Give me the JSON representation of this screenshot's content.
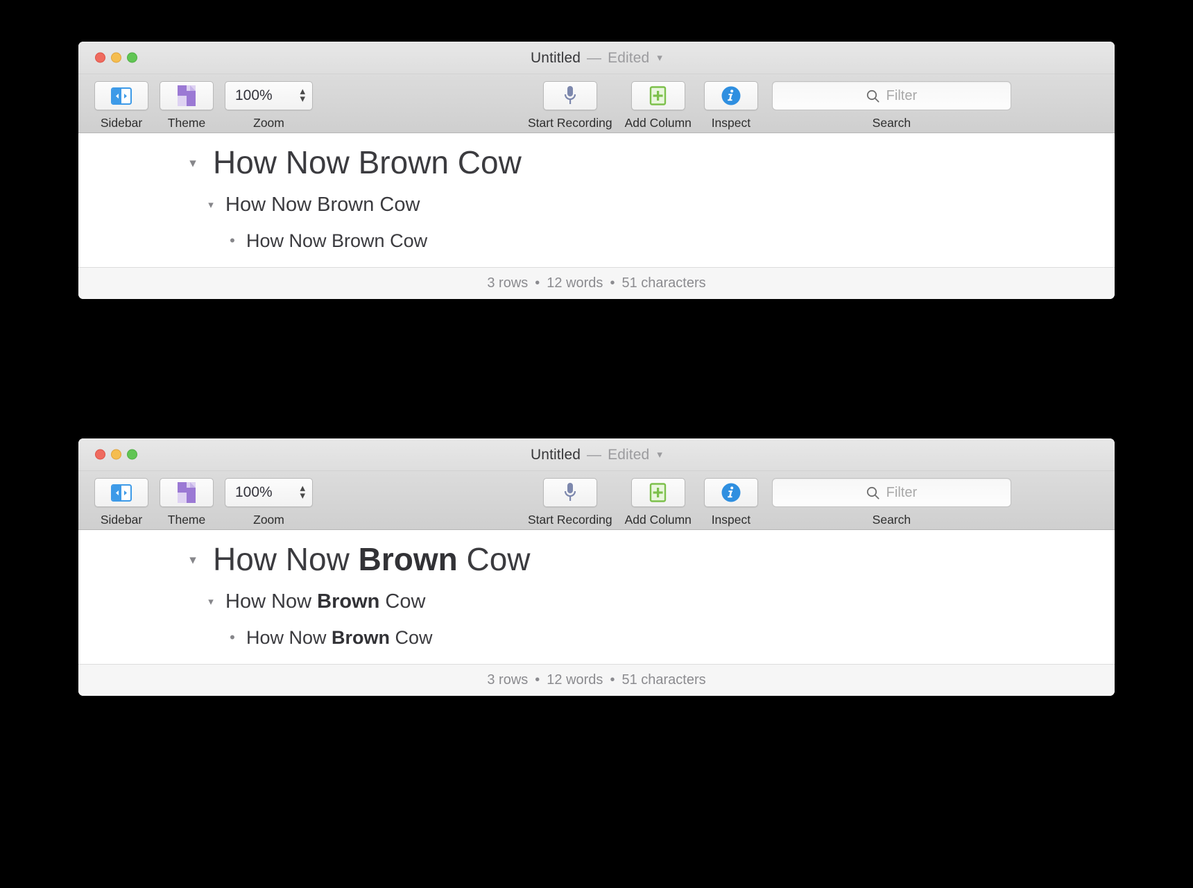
{
  "background_color": "#000000",
  "window": {
    "title": "Untitled",
    "separator": "—",
    "edited_label": "Edited",
    "chevron_icon": "chevron-down-icon",
    "traffic_lights": {
      "close": "#ef6b5f",
      "minimize": "#f5bd4f",
      "maximize": "#61c554"
    }
  },
  "toolbar": {
    "sidebar": {
      "label": "Sidebar",
      "icon": "sidebar-icon",
      "color": "#3d9ae8"
    },
    "theme": {
      "label": "Theme",
      "icon": "theme-icon",
      "color": "#9b79d4"
    },
    "zoom": {
      "label": "Zoom",
      "value": "100%",
      "stepper_icon": "stepper-updown-icon"
    },
    "record": {
      "label": "Start Recording",
      "icon": "microphone-icon",
      "color": "#7d88ad"
    },
    "add_column": {
      "label": "Add Column",
      "icon": "add-column-icon",
      "color": "#7cc04b"
    },
    "inspect": {
      "label": "Inspect",
      "icon": "info-circle-icon",
      "color": "#2f8fe0"
    },
    "search": {
      "label": "Search",
      "placeholder": "Filter",
      "icon": "search-icon"
    }
  },
  "outline": {
    "plain": [
      {
        "marker": "▾",
        "marker_name": "disclosure-triangle-icon",
        "prefix": "How Now ",
        "emphasis": "Brown",
        "suffix": " Cow",
        "bold": false
      },
      {
        "marker": "▾",
        "marker_name": "disclosure-triangle-icon",
        "prefix": "How Now ",
        "emphasis": "Brown",
        "suffix": " Cow",
        "bold": false
      },
      {
        "marker": "•",
        "marker_name": "bullet-icon",
        "prefix": "How Now ",
        "emphasis": "Brown",
        "suffix": " Cow",
        "bold": false
      }
    ],
    "bold": [
      {
        "marker": "▾",
        "marker_name": "disclosure-triangle-icon",
        "prefix": "How Now ",
        "emphasis": "Brown",
        "suffix": " Cow",
        "bold": true
      },
      {
        "marker": "▾",
        "marker_name": "disclosure-triangle-icon",
        "prefix": "How Now ",
        "emphasis": "Brown",
        "suffix": " Cow",
        "bold": true
      },
      {
        "marker": "•",
        "marker_name": "bullet-icon",
        "prefix": "How Now ",
        "emphasis": "Brown",
        "suffix": " Cow",
        "bold": true
      }
    ]
  },
  "status": {
    "rows": "3 rows",
    "dot1": "•",
    "words": "12 words",
    "dot2": "•",
    "characters": "51 characters"
  }
}
